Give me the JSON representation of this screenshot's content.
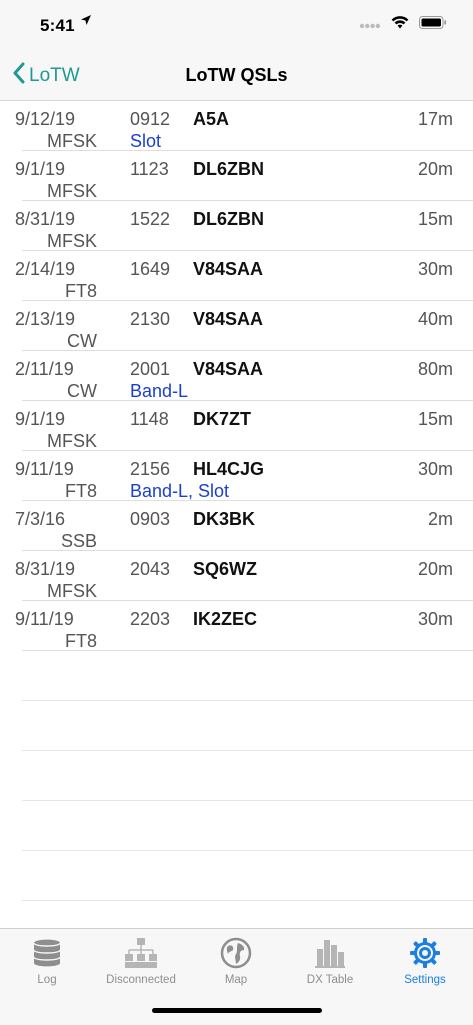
{
  "status": {
    "time": "5:41",
    "location_icon": "location-arrow-icon",
    "signal_icon": "cellular-dots-icon",
    "wifi_icon": "wifi-icon",
    "battery_icon": "battery-icon"
  },
  "nav": {
    "back_label": "LoTW",
    "title": "LoTW QSLs"
  },
  "rows": [
    {
      "date": "9/12/19",
      "mode": "MFSK",
      "time": "0912",
      "note": "Slot",
      "call": "A5A",
      "band": "17m"
    },
    {
      "date": "9/1/19",
      "mode": "MFSK",
      "time": "1123",
      "note": "",
      "call": "DL6ZBN",
      "band": "20m"
    },
    {
      "date": "8/31/19",
      "mode": "MFSK",
      "time": "1522",
      "note": "",
      "call": "DL6ZBN",
      "band": "15m"
    },
    {
      "date": "2/14/19",
      "mode": "FT8",
      "time": "1649",
      "note": "",
      "call": "V84SAA",
      "band": "30m"
    },
    {
      "date": "2/13/19",
      "mode": "CW",
      "time": "2130",
      "note": "",
      "call": "V84SAA",
      "band": "40m"
    },
    {
      "date": "2/11/19",
      "mode": "CW",
      "time": "2001",
      "note": "Band-L",
      "call": "V84SAA",
      "band": "80m"
    },
    {
      "date": "9/1/19",
      "mode": "MFSK",
      "time": "1148",
      "note": "",
      "call": "DK7ZT",
      "band": "15m"
    },
    {
      "date": "9/11/19",
      "mode": "FT8",
      "time": "2156",
      "note": "Band-L, Slot",
      "call": "HL4CJG",
      "band": "30m"
    },
    {
      "date": "7/3/16",
      "mode": "SSB",
      "time": "0903",
      "note": "",
      "call": "DK3BK",
      "band": "2m"
    },
    {
      "date": "8/31/19",
      "mode": "MFSK",
      "time": "2043",
      "note": "",
      "call": "SQ6WZ",
      "band": "20m"
    },
    {
      "date": "9/11/19",
      "mode": "FT8",
      "time": "2203",
      "note": "",
      "call": "IK2ZEC",
      "band": "30m"
    }
  ],
  "tabs": [
    {
      "label": "Log",
      "icon": "database-icon",
      "active": false
    },
    {
      "label": "Disconnected",
      "icon": "network-icon",
      "active": false
    },
    {
      "label": "Map",
      "icon": "globe-icon",
      "active": false
    },
    {
      "label": "DX Table",
      "icon": "bar-chart-icon",
      "active": false
    },
    {
      "label": "Settings",
      "icon": "gear-icon",
      "active": true
    }
  ],
  "colors": {
    "accent": "#1e9a93",
    "link_blue": "#1a3fd1",
    "tab_active": "#1a7fe0",
    "tab_inactive": "#8e8e8e"
  }
}
